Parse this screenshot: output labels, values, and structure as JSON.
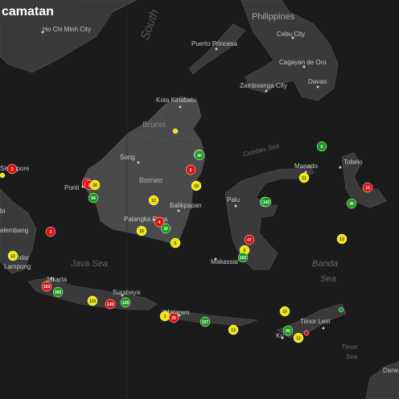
{
  "header": {
    "title": "camatan"
  },
  "places": {
    "ho_chi_minh": "Ho Chi Minh City",
    "philippines": "Philippines",
    "south_sea": "South",
    "cebu": "Cebu City",
    "puerto_princesa": "Puerto Princesa",
    "cagayan": "Cagayan de Oro",
    "davao": "Davao",
    "zamboanga": "Zamboanga City",
    "kota_kinabalu": "Kota Kinabalu",
    "brunei": "Brunei",
    "celebes_sea": "Celebes Sea",
    "song": "Song",
    "borneo": "Borneo",
    "singapore": "Singapore",
    "pontianak": "Ponti",
    "manado": "Manado",
    "tobelo": "Tobelo",
    "palu": "Palu",
    "balikpapan": "Balikpapan",
    "palangka": "Palangka Raya",
    "jambi": "bi",
    "palembang": "alembang",
    "bandar": "ndar",
    "lampung": "Lampung",
    "java_sea": "Java Sea",
    "makassar": "Makassar",
    "banda": "Banda",
    "banda_sea": "Sea",
    "jakarta": "Jakarta",
    "surabaya": "Surabaya",
    "mataram": "Mataram",
    "timor_leste": "Timor Lest",
    "kupang": "Ku",
    "timor_sea_1": "Timor",
    "timor_sea_2": "Sea",
    "darwin": "Darw"
  },
  "markers": [
    {
      "label": "3",
      "color": "#e01010"
    },
    {
      "label": "",
      "color": "#f2e600"
    },
    {
      "label": "3",
      "color": "#e01010"
    },
    {
      "label": "4",
      "color": "#e01010"
    },
    {
      "label": "1",
      "color": "#e01010"
    },
    {
      "label": "30",
      "color": "#f2e600"
    },
    {
      "label": "94",
      "color": "#1a9a1a"
    },
    {
      "label": "5",
      "color": "#1a9a1a"
    },
    {
      "label": "40",
      "color": "#1a9a1a"
    },
    {
      "label": "6",
      "color": "#e01010"
    },
    {
      "label": "10",
      "color": "#f2e600"
    },
    {
      "label": "12",
      "color": "#f2e600"
    },
    {
      "label": "4",
      "color": "#e01010"
    },
    {
      "label": "30",
      "color": "#1a9a1a"
    },
    {
      "label": "15",
      "color": "#f2e600"
    },
    {
      "label": "5",
      "color": "#f2e600"
    },
    {
      "label": "20",
      "color": "#1a9a1a"
    },
    {
      "label": "31",
      "color": "#f2e600"
    },
    {
      "label": "142",
      "color": "#1a9a1a"
    },
    {
      "label": "47",
      "color": "#e01010"
    },
    {
      "label": "6",
      "color": "#f2e600"
    },
    {
      "label": "102",
      "color": "#1a9a1a"
    },
    {
      "label": "153",
      "color": "#e01010"
    },
    {
      "label": "300",
      "color": "#1a9a1a"
    },
    {
      "label": "110",
      "color": "#f2e600"
    },
    {
      "label": "145",
      "color": "#e01010"
    },
    {
      "label": "126",
      "color": "#1a9a1a"
    },
    {
      "label": "3",
      "color": "#f2e600"
    },
    {
      "label": "20",
      "color": "#e01010"
    },
    {
      "label": "107",
      "color": "#1a9a1a"
    },
    {
      "label": "13",
      "color": "#f2e600"
    },
    {
      "label": "10",
      "color": "#f2e600"
    },
    {
      "label": "60",
      "color": "#1a9a1a"
    },
    {
      "label": "12",
      "color": "#f2e600"
    },
    {
      "label": "13",
      "color": "#f2e600"
    },
    {
      "label": "5",
      "color": "#1a9a1a"
    },
    {
      "label": "13",
      "color": "#f2e600"
    },
    {
      "label": "15",
      "color": "#e01010"
    },
    {
      "label": "36",
      "color": "#1a9a1a"
    },
    {
      "label": "",
      "color": "#1a9a1a"
    },
    {
      "label": "",
      "color": "#e01010"
    },
    {
      "label": "",
      "color": "#f2e600"
    }
  ],
  "colors": {
    "water": "#1b1b1b",
    "land": "#3a3a3a",
    "borneo": "#4a4a4a",
    "label": "#9a9a9a"
  }
}
